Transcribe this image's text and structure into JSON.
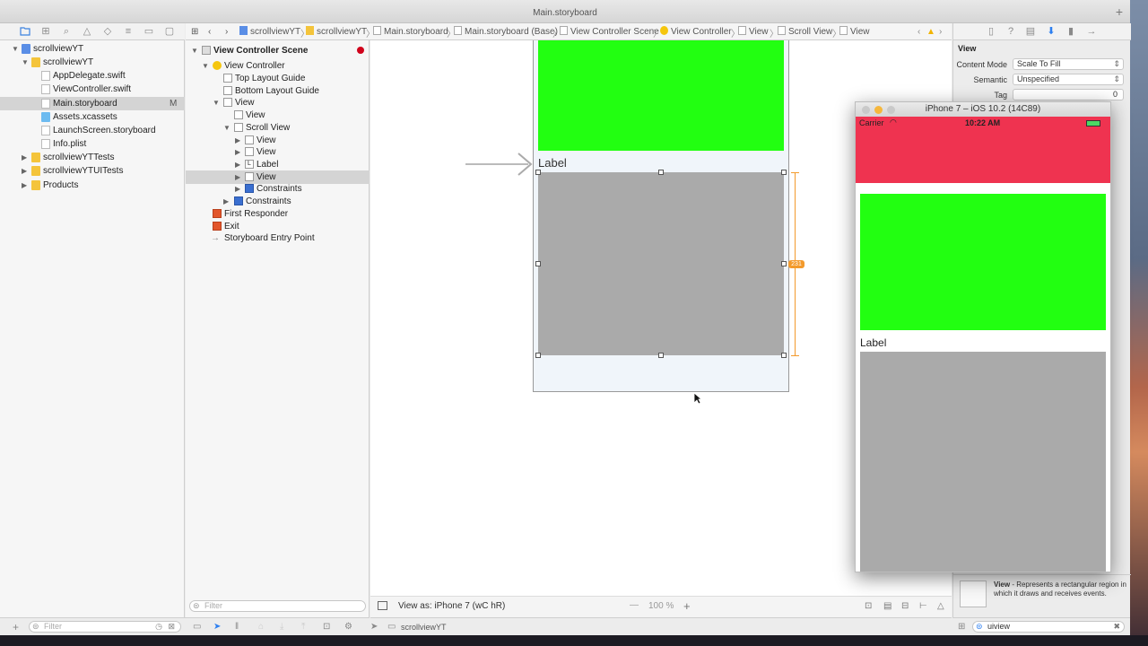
{
  "window": {
    "title": "Main.storyboard",
    "new_tab": "+"
  },
  "navigator_icons": [
    "folder-icon",
    "hierarchy-icon",
    "search-icon",
    "warning-icon",
    "test-icon",
    "debug-icon",
    "breakpoint-icon",
    "report-icon"
  ],
  "project_tree": [
    {
      "label": "scrollviewYT",
      "icon": "proj",
      "depth": 0,
      "disc": "▼"
    },
    {
      "label": "scrollviewYT",
      "icon": "folder",
      "depth": 1,
      "disc": "▼"
    },
    {
      "label": "AppDelegate.swift",
      "icon": "swift",
      "depth": 2,
      "disc": ""
    },
    {
      "label": "ViewController.swift",
      "icon": "swift",
      "depth": 2,
      "disc": ""
    },
    {
      "label": "Main.storyboard",
      "icon": "sb",
      "depth": 2,
      "disc": "",
      "badge": "M",
      "selected": true
    },
    {
      "label": "Assets.xcassets",
      "icon": "assets",
      "depth": 2,
      "disc": ""
    },
    {
      "label": "LaunchScreen.storyboard",
      "icon": "sb",
      "depth": 2,
      "disc": ""
    },
    {
      "label": "Info.plist",
      "icon": "sb",
      "depth": 2,
      "disc": ""
    },
    {
      "label": "scrollviewYTTests",
      "icon": "folder",
      "depth": 1,
      "disc": "▶"
    },
    {
      "label": "scrollviewYTUITests",
      "icon": "folder",
      "depth": 1,
      "disc": "▶"
    },
    {
      "label": "Products",
      "icon": "folder",
      "depth": 1,
      "disc": "▶"
    }
  ],
  "jumpbar": [
    "scrollviewYT",
    "scrollviewYT",
    "Main.storyboard",
    "Main.storyboard (Base)",
    "View Controller Scene",
    "View Controller",
    "View",
    "Scroll View",
    "View"
  ],
  "outline": {
    "scene": "View Controller Scene",
    "items": [
      {
        "label": "View Controller",
        "depth": 1,
        "disc": "▼"
      },
      {
        "label": "Top Layout Guide",
        "depth": 2,
        "disc": ""
      },
      {
        "label": "Bottom Layout Guide",
        "depth": 2,
        "disc": ""
      },
      {
        "label": "View",
        "depth": 2,
        "disc": "▼"
      },
      {
        "label": "View",
        "depth": 3,
        "disc": ""
      },
      {
        "label": "Scroll View",
        "depth": 3,
        "disc": "▼"
      },
      {
        "label": "View",
        "depth": 4,
        "disc": "▶"
      },
      {
        "label": "View",
        "depth": 4,
        "disc": "▶"
      },
      {
        "label": "Label",
        "depth": 4,
        "disc": "▶"
      },
      {
        "label": "View",
        "depth": 4,
        "disc": "▶",
        "selected": true
      },
      {
        "label": "Constraints",
        "depth": 4,
        "disc": "▶"
      },
      {
        "label": "Constraints",
        "depth": 3,
        "disc": "▶"
      },
      {
        "label": "First Responder",
        "depth": 1,
        "disc": ""
      },
      {
        "label": "Exit",
        "depth": 1,
        "disc": ""
      },
      {
        "label": "Storyboard Entry Point",
        "depth": 1,
        "disc": ""
      }
    ],
    "filter_placeholder": "Filter"
  },
  "canvas": {
    "label_text": "Label",
    "constraint_value": "231",
    "view_as": "View as: iPhone 7 (wC hR)",
    "zoom": "100 %",
    "zoom_minus": "—",
    "zoom_plus": "+"
  },
  "inspector": {
    "section": "View",
    "content_mode_label": "Content Mode",
    "content_mode_value": "Scale To Fill",
    "semantic_label": "Semantic",
    "semantic_value": "Unspecified",
    "tag_label": "Tag",
    "tag_value": "0",
    "help_title": "View",
    "help_text": " - Represents a rectangular region in which it draws and receives events.",
    "search_value": "uiview"
  },
  "bottom": {
    "filter_placeholder": "Filter",
    "scheme": "scrollviewYT"
  },
  "simulator": {
    "title": "iPhone 7 – iOS 10.2 (14C89)",
    "carrier": "Carrier",
    "time": "10:22 AM",
    "label_text": "Label"
  },
  "colors": {
    "green": "#22ff11",
    "gray_view": "#aaaaaa",
    "nav_red": "#ef3350",
    "orange": "#f39a2c"
  }
}
